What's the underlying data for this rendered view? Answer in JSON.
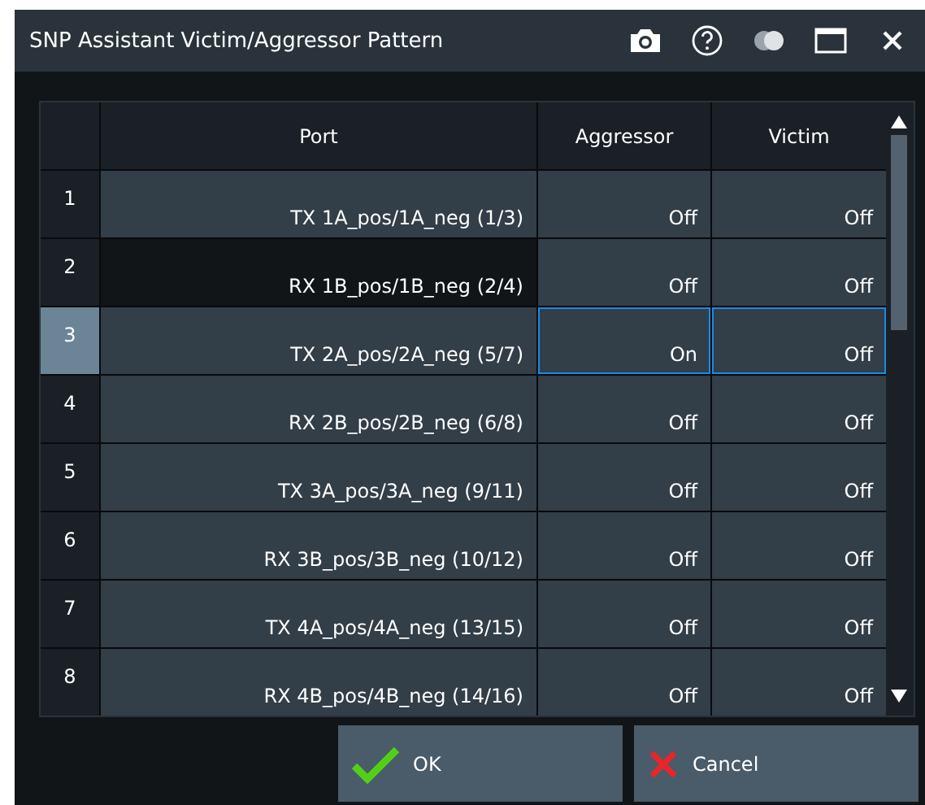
{
  "window": {
    "title": "SNP Assistant Victim/Aggressor Pattern"
  },
  "table": {
    "columns": [
      "Port",
      "Aggressor",
      "Victim"
    ],
    "rows": [
      {
        "number": "1",
        "port": "TX 1A_pos/1A_neg (1/3)",
        "aggressor": "Off",
        "victim": "Off",
        "selected": false,
        "port_focused": false
      },
      {
        "number": "2",
        "port": "RX 1B_pos/1B_neg (2/4)",
        "aggressor": "Off",
        "victim": "Off",
        "selected": false,
        "port_focused": true
      },
      {
        "number": "3",
        "port": "TX 2A_pos/2A_neg (5/7)",
        "aggressor": "On",
        "victim": "Off",
        "selected": true,
        "port_focused": false
      },
      {
        "number": "4",
        "port": "RX 2B_pos/2B_neg (6/8)",
        "aggressor": "Off",
        "victim": "Off",
        "selected": false,
        "port_focused": false
      },
      {
        "number": "5",
        "port": "TX 3A_pos/3A_neg (9/11)",
        "aggressor": "Off",
        "victim": "Off",
        "selected": false,
        "port_focused": false
      },
      {
        "number": "6",
        "port": "RX 3B_pos/3B_neg (10/12)",
        "aggressor": "Off",
        "victim": "Off",
        "selected": false,
        "port_focused": false
      },
      {
        "number": "7",
        "port": "TX 4A_pos/4A_neg (13/15)",
        "aggressor": "Off",
        "victim": "Off",
        "selected": false,
        "port_focused": false
      },
      {
        "number": "8",
        "port": "RX 4B_pos/4B_neg (14/16)",
        "aggressor": "Off",
        "victim": "Off",
        "selected": false,
        "port_focused": false
      }
    ]
  },
  "buttons": [
    {
      "kind": "ok",
      "label": "OK"
    },
    {
      "kind": "cancel",
      "label": "Cancel"
    }
  ]
}
